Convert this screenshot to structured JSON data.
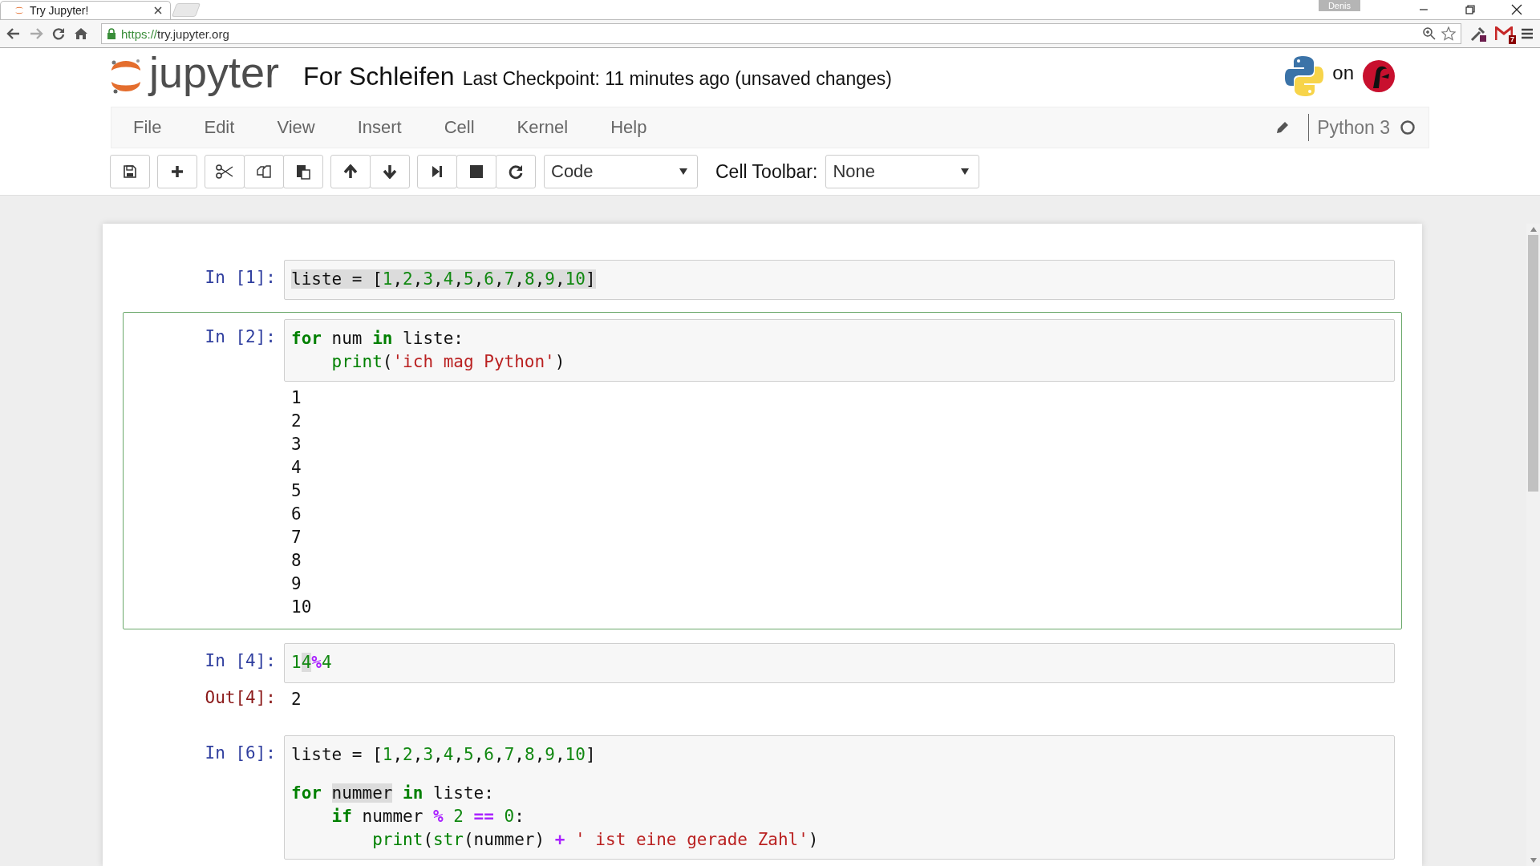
{
  "browser": {
    "tab_title": "Try Jupyter!",
    "url_scheme": "https://",
    "url_host": "try.jupyter.org",
    "profile": "Denis",
    "extension_badge": "7"
  },
  "header": {
    "logo_text": "jupyter",
    "notebook_title": "For Schleifen",
    "checkpoint": "Last Checkpoint: 11 minutes ago (unsaved changes)",
    "hosted_on": "on"
  },
  "menu": [
    "File",
    "Edit",
    "View",
    "Insert",
    "Cell",
    "Kernel",
    "Help"
  ],
  "kernel": {
    "name": "Python 3",
    "busy": false
  },
  "cell_type_select": "Code",
  "cell_toolbar": {
    "label": "Cell Toolbar:",
    "value": "None"
  },
  "cells": [
    {
      "prompt": "In [1]:",
      "selected": false,
      "lines": [
        {
          "tokens": [
            {
              "kind": "plain",
              "text": "liste = [",
              "hl": true
            },
            {
              "kind": "num",
              "text": "1",
              "hl": true
            },
            {
              "kind": "plain",
              "text": ",",
              "hl": true
            },
            {
              "kind": "num",
              "text": "2",
              "hl": true
            },
            {
              "kind": "plain",
              "text": ",",
              "hl": true
            },
            {
              "kind": "num",
              "text": "3",
              "hl": true
            },
            {
              "kind": "plain",
              "text": ",",
              "hl": true
            },
            {
              "kind": "num",
              "text": "4",
              "hl": true
            },
            {
              "kind": "plain",
              "text": ",",
              "hl": true
            },
            {
              "kind": "num",
              "text": "5",
              "hl": true
            },
            {
              "kind": "plain",
              "text": ",",
              "hl": true
            },
            {
              "kind": "num",
              "text": "6",
              "hl": true
            },
            {
              "kind": "plain",
              "text": ",",
              "hl": true
            },
            {
              "kind": "num",
              "text": "7",
              "hl": true
            },
            {
              "kind": "plain",
              "text": ",",
              "hl": true
            },
            {
              "kind": "num",
              "text": "8",
              "hl": true
            },
            {
              "kind": "plain",
              "text": ",",
              "hl": true
            },
            {
              "kind": "num",
              "text": "9",
              "hl": true
            },
            {
              "kind": "plain",
              "text": ",",
              "hl": true
            },
            {
              "kind": "num",
              "text": "10",
              "hl": true
            },
            {
              "kind": "plain",
              "text": "]",
              "hl": true
            }
          ]
        }
      ]
    },
    {
      "prompt": "In [2]:",
      "selected": true,
      "lines": [
        {
          "tokens": [
            {
              "kind": "kw",
              "text": "for",
              "hl": false
            },
            {
              "kind": "plain",
              "text": " num ",
              "hl": false
            },
            {
              "kind": "kw",
              "text": "in",
              "hl": false
            },
            {
              "kind": "plain",
              "text": " liste:",
              "hl": false
            }
          ]
        },
        {
          "tokens": [
            {
              "kind": "builtin",
              "text": "    print",
              "hl": false
            },
            {
              "kind": "plain",
              "text": "(",
              "hl": false
            },
            {
              "kind": "str",
              "text": "'ich mag Python'",
              "hl": false
            },
            {
              "kind": "plain",
              "text": ")",
              "hl": false
            }
          ]
        }
      ],
      "outputs": [
        "1",
        "2",
        "3",
        "4",
        "5",
        "6",
        "7",
        "8",
        "9",
        "10"
      ]
    },
    {
      "prompt": "In [4]:",
      "selected": false,
      "lines": [
        {
          "tokens": [
            {
              "kind": "num",
              "text": "1",
              "hl": false
            },
            {
              "kind": "num",
              "text": "4",
              "hl": true
            },
            {
              "kind": "op",
              "text": "%",
              "hl": false
            },
            {
              "kind": "num",
              "text": "4",
              "hl": false
            }
          ]
        }
      ],
      "output_prompt": "Out[4]:",
      "outputs": [
        "2"
      ]
    },
    {
      "prompt": "In [6]:",
      "selected": false,
      "lines": [
        {
          "tokens": [
            {
              "kind": "plain",
              "text": "liste = [",
              "hl": false
            },
            {
              "kind": "num",
              "text": "1",
              "hl": false
            },
            {
              "kind": "plain",
              "text": ",",
              "hl": false
            },
            {
              "kind": "num",
              "text": "2",
              "hl": false
            },
            {
              "kind": "plain",
              "text": ",",
              "hl": false
            },
            {
              "kind": "num",
              "text": "3",
              "hl": false
            },
            {
              "kind": "plain",
              "text": ",",
              "hl": false
            },
            {
              "kind": "num",
              "text": "4",
              "hl": false
            },
            {
              "kind": "plain",
              "text": ",",
              "hl": false
            },
            {
              "kind": "num",
              "text": "5",
              "hl": false
            },
            {
              "kind": "plain",
              "text": ",",
              "hl": false
            },
            {
              "kind": "num",
              "text": "6",
              "hl": false
            },
            {
              "kind": "plain",
              "text": ",",
              "hl": false
            },
            {
              "kind": "num",
              "text": "7",
              "hl": false
            },
            {
              "kind": "plain",
              "text": ",",
              "hl": false
            },
            {
              "kind": "num",
              "text": "8",
              "hl": false
            },
            {
              "kind": "plain",
              "text": ",",
              "hl": false
            },
            {
              "kind": "num",
              "text": "9",
              "hl": false
            },
            {
              "kind": "plain",
              "text": ",",
              "hl": false
            },
            {
              "kind": "num",
              "text": "10",
              "hl": false
            },
            {
              "kind": "plain",
              "text": "]",
              "hl": false
            }
          ]
        },
        {
          "kind": "blank"
        },
        {
          "tokens": [
            {
              "kind": "kw",
              "text": "for ",
              "hl": false
            },
            {
              "kind": "plain",
              "text": "nummer",
              "hl": true
            },
            {
              "kind": "kw",
              "text": " in",
              "hl": false
            },
            {
              "kind": "plain",
              "text": " liste:",
              "hl": false
            }
          ]
        },
        {
          "tokens": [
            {
              "kind": "kw",
              "text": "    if",
              "hl": false
            },
            {
              "kind": "plain",
              "text": " nummer ",
              "hl": false
            },
            {
              "kind": "op",
              "text": "%",
              "hl": false
            },
            {
              "kind": "num",
              "text": " 2",
              "hl": false
            },
            {
              "kind": "op",
              "text": " ==",
              "hl": false
            },
            {
              "kind": "num",
              "text": " 0",
              "hl": false
            },
            {
              "kind": "plain",
              "text": ":",
              "hl": false
            }
          ]
        },
        {
          "tokens": [
            {
              "kind": "builtin",
              "text": "        print",
              "hl": false
            },
            {
              "kind": "plain",
              "text": "(",
              "hl": false
            },
            {
              "kind": "builtin",
              "text": "str",
              "hl": false
            },
            {
              "kind": "plain",
              "text": "(nummer) ",
              "hl": false
            },
            {
              "kind": "op",
              "text": "+ ",
              "hl": false
            },
            {
              "kind": "str",
              "text": "' ist eine gerade Zahl'",
              "hl": false
            },
            {
              "kind": "plain",
              "text": ")",
              "hl": false
            }
          ]
        }
      ]
    }
  ]
}
